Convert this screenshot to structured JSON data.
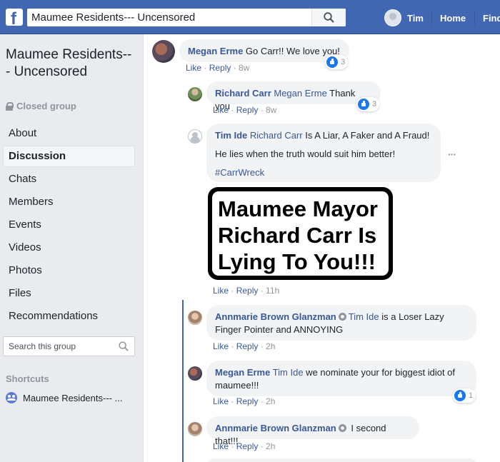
{
  "topbar": {
    "logo": "f",
    "search_value": "Maumee Residents--- Uncensored",
    "user_name": "Tim",
    "home_label": "Home",
    "find_label": "Find"
  },
  "sidebar": {
    "group_name": "Maumee Residents--- Uncensored",
    "privacy": "Closed group",
    "items": [
      "About",
      "Discussion",
      "Chats",
      "Members",
      "Events",
      "Videos",
      "Photos",
      "Files",
      "Recommendations"
    ],
    "active_item": "Discussion",
    "search_placeholder": "Search this group",
    "shortcuts_title": "Shortcuts",
    "shortcut_item": "Maumee Residents--- ..."
  },
  "comments": [
    {
      "author": "Megan Erme",
      "text": " Go Carr!! We love you!",
      "like": "Like",
      "reply": "Reply",
      "time": "8w",
      "reactions": "3"
    },
    {
      "author": "Richard Carr",
      "mention": "Megan Erme",
      "text": " Thank you",
      "like": "Like",
      "reply": "Reply",
      "time": "8w",
      "reactions": "3"
    },
    {
      "author": "Tim Ide",
      "mention": "Richard Carr",
      "text": " Is A Liar, A Faker and A Fraud!",
      "line2": "He lies when the truth would suit him better!",
      "hashtag": "#CarrWreck",
      "image_text": "Maumee Mayor Richard Carr Is Lying To You!!!",
      "like": "Like",
      "reply": "Reply",
      "time": "11h"
    },
    {
      "author": "Annmarie Brown Glanzman",
      "mention": "Tim Ide",
      "text": " is a Loser Lazy Finger Pointer and ANNOYING",
      "like": "Like",
      "reply": "Reply",
      "time": "2h"
    },
    {
      "author": "Megan Erme",
      "mention": "Tim Ide",
      "text": " we nominate your for biggest idiot of maumee!!!",
      "like": "Like",
      "reply": "Reply",
      "time": "2h",
      "reactions": "1"
    },
    {
      "author": "Annmarie Brown Glanzman",
      "text": " I second that!!!",
      "like": "Like",
      "reply": "Reply",
      "time": "2h"
    }
  ],
  "colors": {
    "brand": "#4267b2",
    "link": "#385898",
    "like_blue": "#1877f2"
  }
}
